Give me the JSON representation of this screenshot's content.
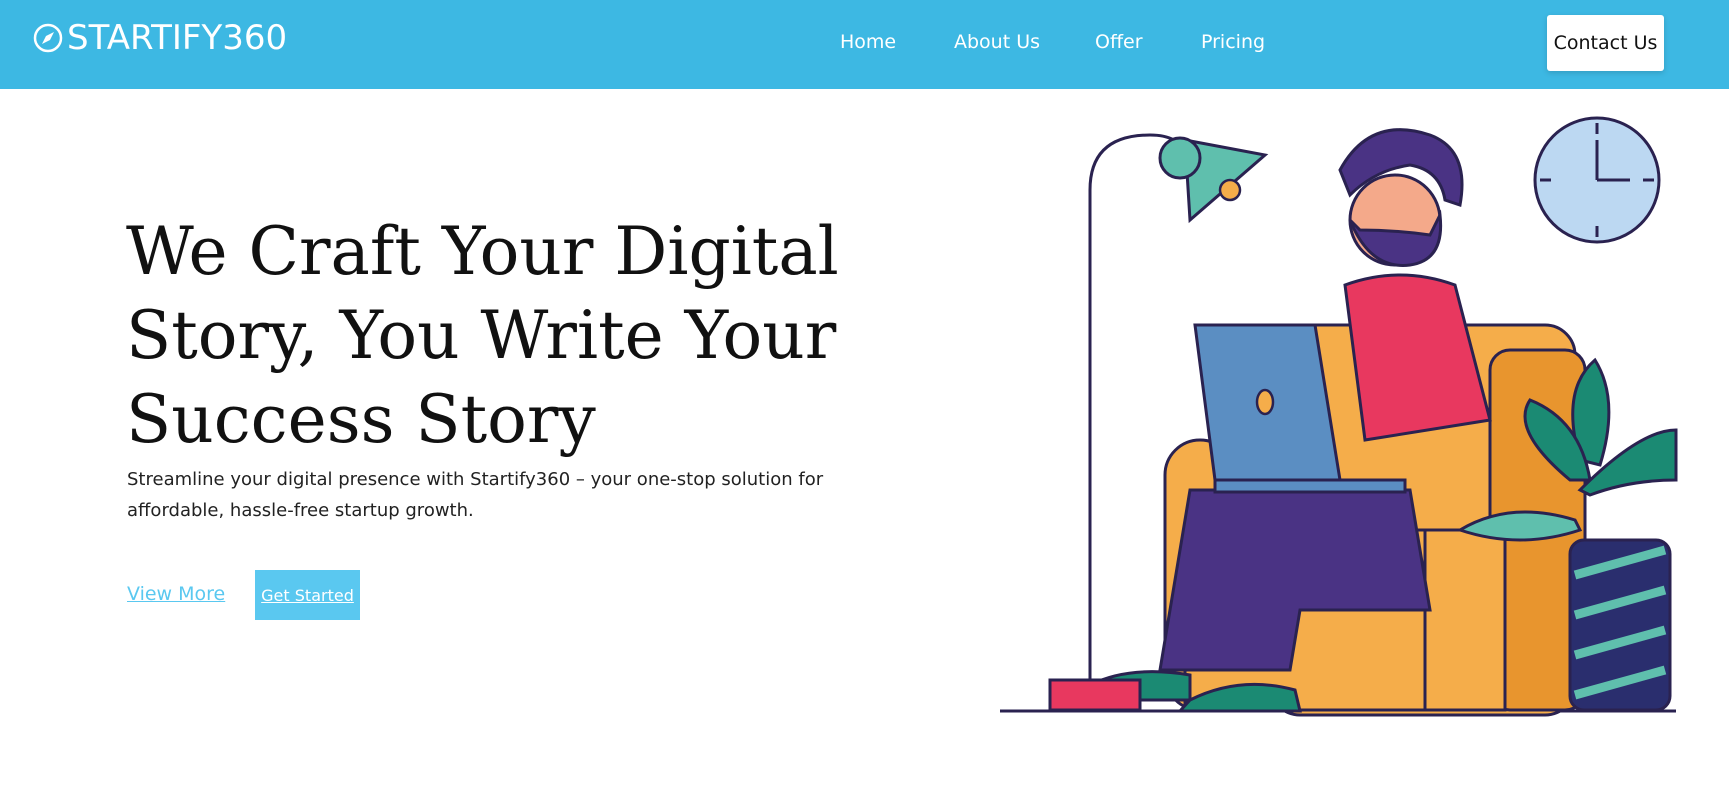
{
  "brand": {
    "name": "STARTIFY360",
    "icon": "compass-icon"
  },
  "nav": {
    "links": [
      "Home",
      "About Us",
      "Offer",
      "Pricing"
    ],
    "contact_label": "Contact Us"
  },
  "hero": {
    "title": "We Craft Your Digital Story, You Write Your Success Story",
    "subtitle": "Streamline your digital presence with Startify360 – your one-stop solution for affordable, hassle-free startup growth.",
    "view_more_label": "View More",
    "get_started_label": "Get Started"
  },
  "colors": {
    "header_bg": "#3db8e3",
    "accent": "#5ac8f0",
    "armchair": "#f5ad4a",
    "shirt": "#e8385f",
    "pants": "#4a3384",
    "laptop": "#5b8ec2",
    "plant": "#1b8a73"
  }
}
